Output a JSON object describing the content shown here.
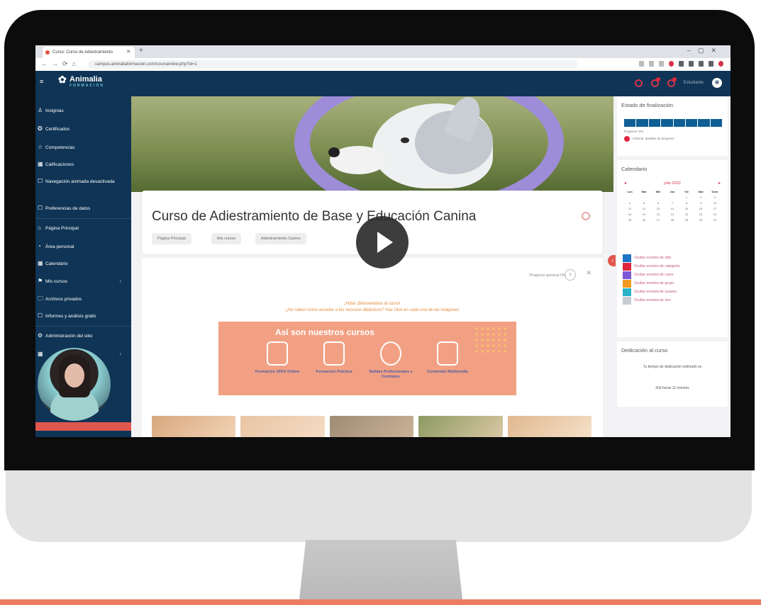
{
  "browser": {
    "tab_title": "Curso: Curso de Adiestramiento",
    "url": "campus.animaliaformacion.com/course/view.php?id=1"
  },
  "site": {
    "brand_name": "Animalia",
    "brand_sub": "FORMACIÓN",
    "user_label": "Estudiante"
  },
  "sidebar": {
    "items": [
      {
        "label": "Insignias",
        "icon": "badge-icon"
      },
      {
        "label": "Certificados",
        "icon": "certificate-icon"
      },
      {
        "label": "Competencias",
        "icon": "competencies-icon"
      },
      {
        "label": "Calificaciones",
        "icon": "grades-icon"
      },
      {
        "label": "Navegación animada desactivada",
        "icon": "animation-icon"
      },
      {
        "label": "Preferencias de datos",
        "icon": "data-preferences-icon"
      },
      {
        "label": "Página Principal",
        "icon": "home-icon"
      },
      {
        "label": "Área personal",
        "icon": "dashboard-icon"
      },
      {
        "label": "Calendario",
        "icon": "calendar-icon"
      },
      {
        "label": "Mis cursos",
        "icon": "courses-icon"
      },
      {
        "label": "Archivos privados",
        "icon": "files-icon"
      },
      {
        "label": "Informes y análisis gratis",
        "icon": "reports-icon"
      },
      {
        "label": "Administración del sitio",
        "icon": "admin-icon"
      }
    ]
  },
  "course": {
    "title": "Curso de Adiestramiento de Base y Educación Canina",
    "breadcrumb": [
      "Página Principal",
      "Mis cursos",
      "Adiestramiento Canino"
    ],
    "progress_label": "Progreso general 0%",
    "progress_value": "0",
    "welcome_line1": "¡Hola! ¡Bienvenido/a al curso!",
    "welcome_line2": "¿No sabes cómo acceder a los recursos didácticos? Haz click en cada una de las imágenes",
    "banner_title": "Así son nuestros cursos",
    "features": [
      {
        "label": "Formación 100% Online",
        "icon": "online-icon"
      },
      {
        "label": "Formación Práctica",
        "icon": "practice-icon"
      },
      {
        "label": "Salidas Profesionales y Contratos",
        "icon": "career-icon"
      },
      {
        "label": "Contenido Multimedia",
        "icon": "multimedia-icon"
      }
    ]
  },
  "right": {
    "completion_title": "Estado de finalización",
    "completion_progress": "Progreso: 0%",
    "completion_note": "Informe: detalles de progreso",
    "calendar_title": "Calendario",
    "calendar_month": "julio 2022",
    "weekdays": [
      "Lun",
      "Mar",
      "Mié",
      "Jue",
      "Vie",
      "Sáb",
      "Dom"
    ],
    "days": [
      "",
      "",
      "",
      "",
      "1",
      "2",
      "3",
      "4",
      "5",
      "6",
      "7",
      "8",
      "9",
      "10",
      "11",
      "12",
      "13",
      "14",
      "15",
      "16",
      "17",
      "18",
      "19",
      "20",
      "21",
      "22",
      "23",
      "24",
      "25",
      "26",
      "27",
      "28",
      "29",
      "30",
      "31"
    ],
    "filters": [
      {
        "label": "Ocultar eventos de sitio",
        "color": "#1e73c8"
      },
      {
        "label": "Ocultar eventos de categoría",
        "color": "#e0263e"
      },
      {
        "label": "Ocultar eventos de curso",
        "color": "#7b58d6"
      },
      {
        "label": "Ocultar eventos de grupo",
        "color": "#f29a21"
      },
      {
        "label": "Ocultar eventos de usuario",
        "color": "#2bb3c8"
      },
      {
        "label": "Ocultar eventos de otro",
        "color": "#c7ccd3"
      }
    ],
    "dedication_title": "Dedicación al curso",
    "dedication_text": "Tu tiempo de dedicación estimado es",
    "dedication_value": "30d horas 11 minutos"
  },
  "colors": {
    "navy": "#0f3455",
    "accent": "#e0574d",
    "banner": "#f2a083"
  }
}
